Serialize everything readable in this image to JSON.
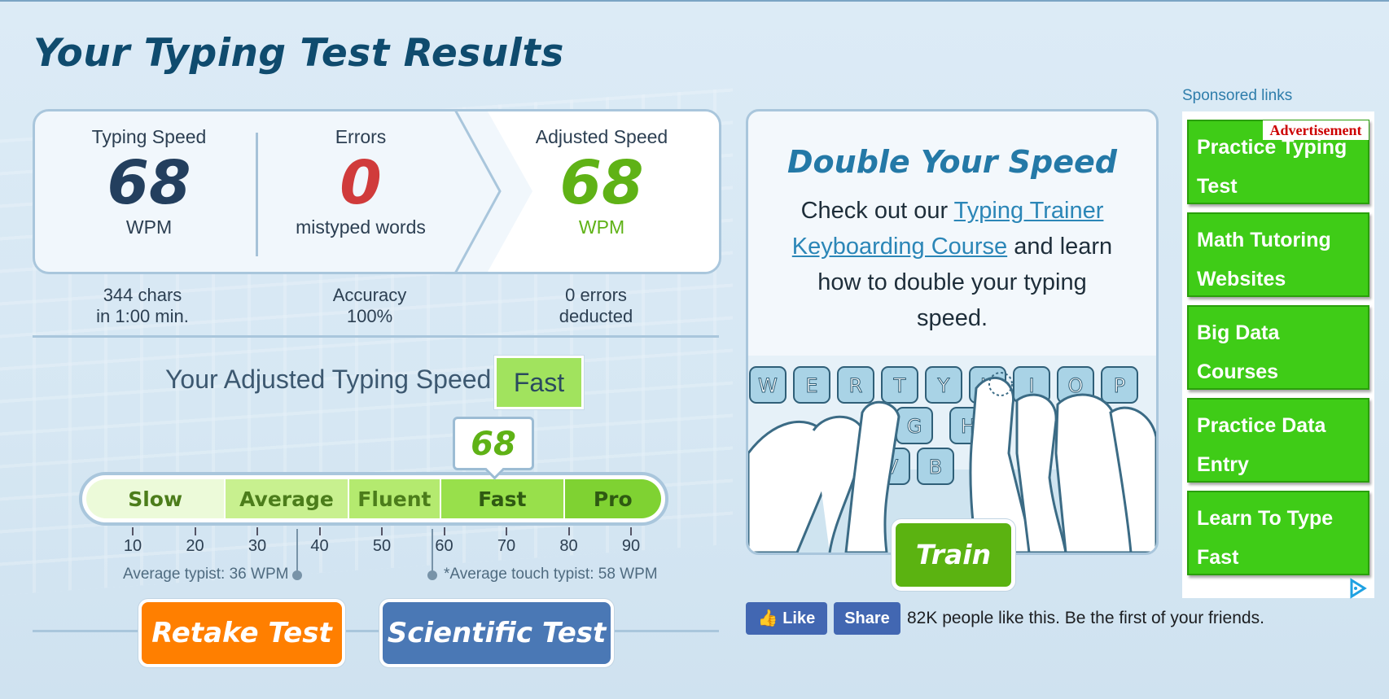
{
  "page_title": "Your Typing Test Results",
  "results": {
    "typing_speed": {
      "label": "Typing Speed",
      "value": "68",
      "unit": "WPM"
    },
    "errors": {
      "label": "Errors",
      "value": "0",
      "unit": "mistyped words"
    },
    "adjusted_speed": {
      "label": "Adjusted Speed",
      "value": "68",
      "unit": "WPM"
    }
  },
  "substats": {
    "chars": "344 chars",
    "time": "in 1:00 min.",
    "accuracy_label": "Accuracy",
    "accuracy_value": "100%",
    "errors_count": "0 errors",
    "errors_note": "deducted"
  },
  "rating": {
    "prefix": "Your Adjusted Typing Speed is",
    "value": "Fast",
    "marker_value": "68"
  },
  "scale": {
    "segments": [
      "Slow",
      "Average",
      "Fluent",
      "Fast",
      "Pro"
    ],
    "segment_colors": [
      "#ecfad9",
      "#c8f08f",
      "#b4ea6f",
      "#98e04b",
      "#7fd232"
    ],
    "ticks": [
      "10",
      "20",
      "30",
      "40",
      "50",
      "60",
      "70",
      "80",
      "90"
    ],
    "average_typist": "Average typist: 36 WPM",
    "touch_typist": "*Average touch typist: 58 WPM"
  },
  "buttons": {
    "retake": "Retake Test",
    "scientific": "Scientific Test"
  },
  "promo": {
    "title": "Double Your Speed",
    "text_before": "Check out our",
    "link": "Typing Trainer Keyboarding Course",
    "text_after": "and learn how to double your typing speed.",
    "train_button": "Train",
    "keys_row1": [
      "W",
      "E",
      "R",
      "T",
      "Y",
      "U",
      "I",
      "O",
      "P"
    ],
    "keys_row2": [
      "G",
      "H"
    ],
    "keys_row3": [
      "V",
      "B"
    ]
  },
  "facebook": {
    "like": "Like",
    "share": "Share",
    "text": "82K people like this. Be the first of your friends."
  },
  "ads": {
    "sponsored_label": "Sponsored links",
    "advertisement_label": "Advertisement",
    "items": [
      "Practice Typing Test",
      "Math Tutoring Websites",
      "Big Data Courses",
      "Practice Data Entry",
      "Learn To Type Fast"
    ]
  },
  "colors": {
    "speed_dark": "#233f5e",
    "error_red": "#d03b3b",
    "adjusted_green": "#5fb216",
    "retake_orange": "#ff7f00",
    "scientific_blue": "#4a78b5"
  }
}
